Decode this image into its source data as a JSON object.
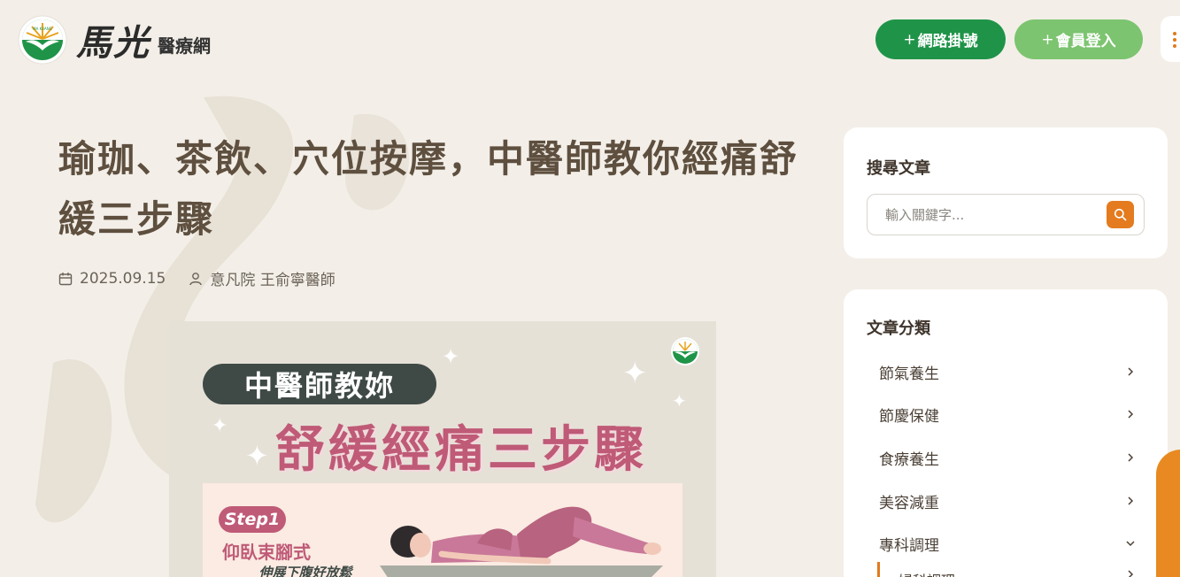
{
  "header": {
    "logo_name": "馬光",
    "logo_sub": "醫療網",
    "logo_badge_text": "MA KUANG",
    "register_button": "網路掛號",
    "login_button": "會員登入"
  },
  "article": {
    "title": "瑜珈、茶飲、穴位按摩，中醫師教你經痛舒緩三步驟",
    "date": "2025.09.15",
    "author": "意凡院 王俞寧醫師"
  },
  "poster": {
    "pill_text": "中醫師教妳",
    "headline": "舒緩經痛三步驟",
    "step_badge": "Step1",
    "step_title": "仰臥束腳式",
    "step_subtitle": "_伸展下腹好放鬆"
  },
  "sidebar": {
    "search": {
      "title": "搜尋文章",
      "placeholder": "輸入關鍵字..."
    },
    "categories": {
      "title": "文章分類",
      "items": [
        {
          "label": "節氣養生",
          "chevron": "chevron-right-icon"
        },
        {
          "label": "節慶保健",
          "chevron": "chevron-right-icon"
        },
        {
          "label": "食療養生",
          "chevron": "chevron-right-icon"
        },
        {
          "label": "美容減重",
          "chevron": "chevron-right-icon"
        },
        {
          "label": "專科調理",
          "chevron": "chevron-down-icon"
        }
      ],
      "sub_items": [
        {
          "label": "婦科調理"
        }
      ]
    }
  },
  "colors": {
    "background": "#f3efe8",
    "brand_green": "#1f9448",
    "light_green": "#7cc46f",
    "accent_orange": "#e47b1f",
    "poster_pink": "#bf5a77"
  }
}
